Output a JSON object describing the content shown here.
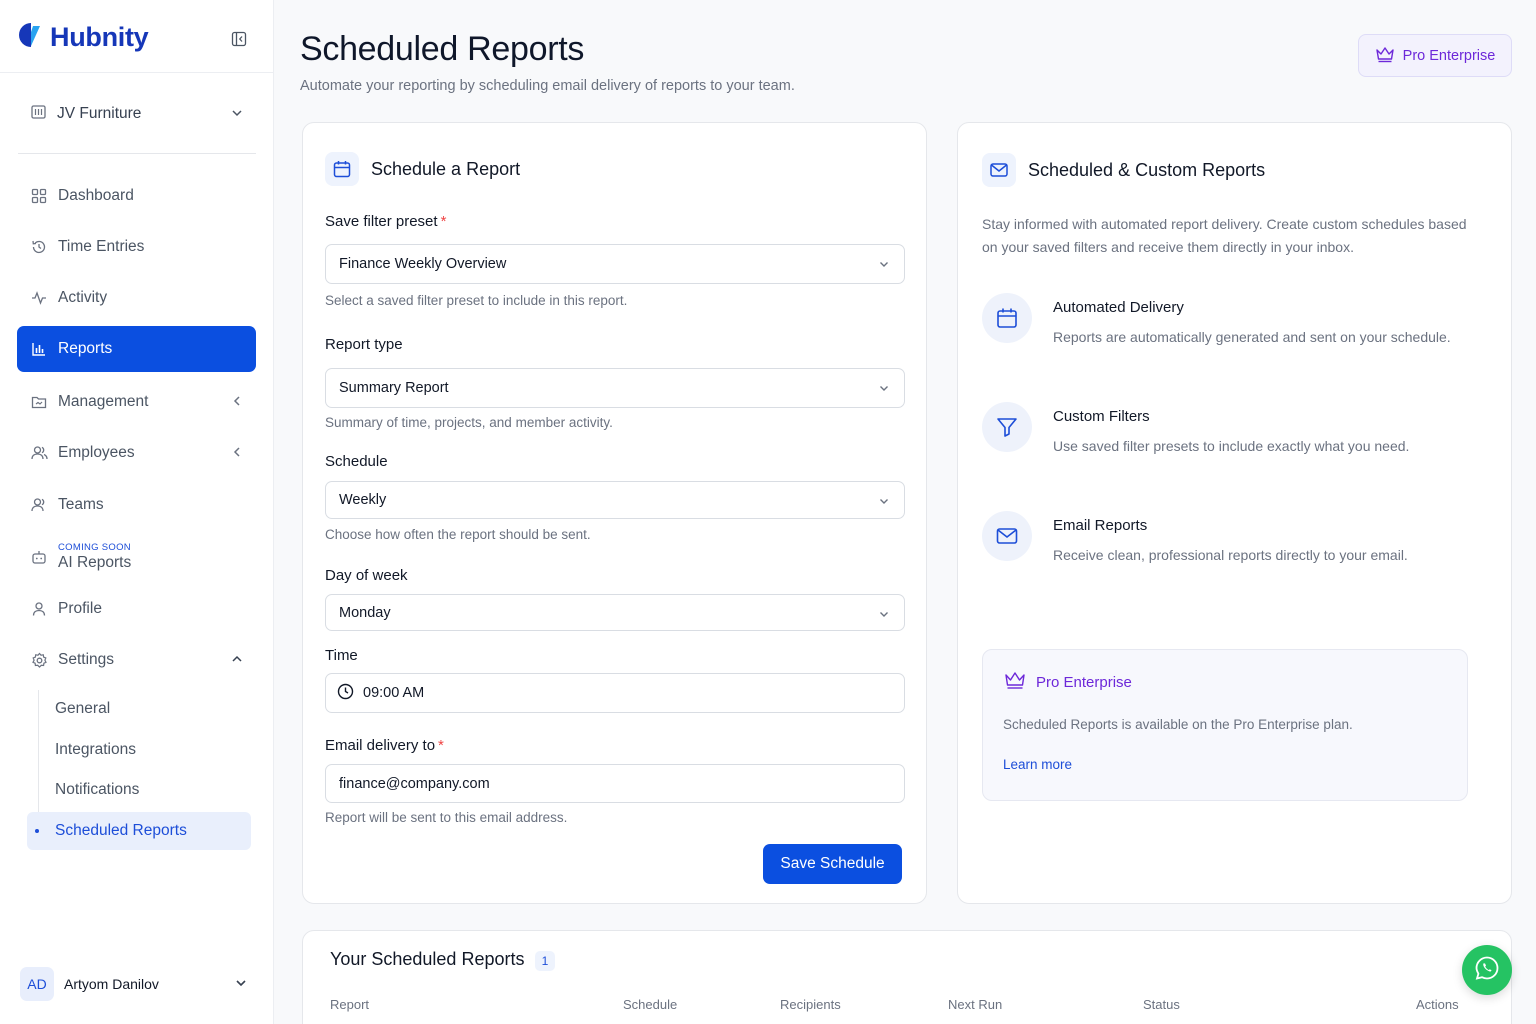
{
  "brand": {
    "name": "Hubnity",
    "accent": "#1637b8"
  },
  "workspace": {
    "name": "JV Furniture"
  },
  "nav": {
    "items": [
      {
        "label": "Dashboard",
        "icon": "grid-icon"
      },
      {
        "label": "Time Entries",
        "icon": "history-icon"
      },
      {
        "label": "Activity",
        "icon": "activity-icon"
      },
      {
        "label": "Reports",
        "icon": "bar-chart-icon",
        "active": true
      },
      {
        "label": "Management",
        "icon": "folder-icon"
      },
      {
        "label": "Employees",
        "icon": "users-icon"
      },
      {
        "label": "Teams",
        "icon": "users-icon"
      },
      {
        "label": "AI Reports",
        "icon": "bot-icon",
        "badge": "COMING SOON"
      },
      {
        "label": "Profile",
        "icon": "user-icon"
      },
      {
        "label": "Settings",
        "icon": "gear-icon"
      }
    ],
    "settings_sub": [
      "General",
      "Integrations",
      "Notifications",
      "Scheduled Reports"
    ]
  },
  "user": {
    "initials": "AD",
    "name": "Artyom Danilov"
  },
  "header": {
    "title": "Scheduled Reports",
    "subtitle": "Automate your reporting by scheduling email delivery of reports to your team.",
    "plan_button": "Pro Enterprise"
  },
  "form": {
    "title": "Schedule a Report",
    "preset": {
      "label": "Save filter preset",
      "value": "Finance Weekly Overview",
      "help": "Select a saved filter preset to include in this report."
    },
    "report_type": {
      "label": "Report type",
      "value": "Summary Report",
      "help": "Summary of time, projects, and member activity."
    },
    "schedule": {
      "label": "Schedule",
      "value": "Weekly",
      "help": "Choose how often the report should be sent."
    },
    "day": {
      "label": "Day of week",
      "value": "Monday"
    },
    "time": {
      "label": "Time",
      "value": "09:00 AM"
    },
    "email": {
      "label": "Email delivery to",
      "value": "finance@company.com",
      "help": "Report will be sent to this email address."
    },
    "required_mark": "*",
    "submit": "Save Schedule"
  },
  "info": {
    "title": "Scheduled & Custom Reports",
    "description": "Stay informed with automated report delivery. Create custom schedules based on your saved filters and receive them directly in your inbox.",
    "features": [
      {
        "title": "Automated Delivery",
        "desc": "Reports are automatically generated and sent on your schedule.",
        "icon": "calendar-icon"
      },
      {
        "title": "Custom Filters",
        "desc": "Use saved filter presets to include exactly what you need.",
        "icon": "filter-icon"
      },
      {
        "title": "Email Reports",
        "desc": "Receive clean, professional reports directly to your email.",
        "icon": "mail-icon"
      }
    ],
    "plan_box": {
      "title": "Pro Enterprise",
      "desc": "Scheduled Reports is available on the Pro Enterprise plan.",
      "link": "Learn more"
    }
  },
  "scheduled_list": {
    "title": "Your Scheduled Reports",
    "count": "1",
    "columns": [
      "Report",
      "Schedule",
      "Recipients",
      "Next Run",
      "Status",
      "Actions"
    ]
  },
  "colors": {
    "primary": "#0b4fe0",
    "purple": "#6d28d9",
    "whatsapp": "#25c363"
  }
}
